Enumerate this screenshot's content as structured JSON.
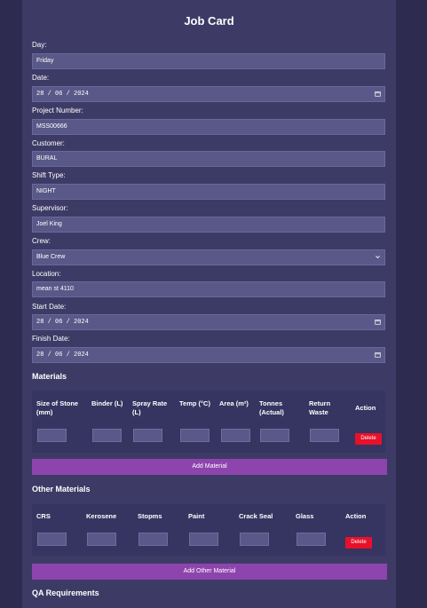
{
  "form": {
    "title": "Job Card",
    "fields": {
      "day": {
        "label": "Day:",
        "value": "Friday"
      },
      "date": {
        "label": "Date:",
        "value": "28 / 06 / 2024"
      },
      "project_number": {
        "label": "Project Number:",
        "value": "MSS00666"
      },
      "customer": {
        "label": "Customer:",
        "value": "BURAL"
      },
      "shift_type": {
        "label": "Shift Type:",
        "value": "NIGHT"
      },
      "supervisor": {
        "label": "Supervisor:",
        "value": "Joel King"
      },
      "crew": {
        "label": "Crew:",
        "value": "Blue Crew"
      },
      "location": {
        "label": "Location:",
        "value": "mean st 4110"
      },
      "start_date": {
        "label": "Start Date:",
        "value": "28 / 06 / 2024"
      },
      "finish_date": {
        "label": "Finish Date:",
        "value": "28 / 06 / 2024"
      }
    }
  },
  "materials": {
    "heading": "Materials",
    "columns": [
      "Size of Stone (mm)",
      "Binder (L)",
      "Spray Rate (L)",
      "Temp (°C)",
      "Area (m²)",
      "Tonnes (Actual)",
      "Return Waste",
      "Action"
    ],
    "delete_label": "Delete",
    "add_label": "Add Material"
  },
  "other_materials": {
    "heading": "Other Materials",
    "columns": [
      "CRS",
      "Kerosene",
      "Stopms",
      "Paint",
      "Crack Seal",
      "Glass",
      "Action"
    ],
    "delete_label": "Delete",
    "add_label": "Add Other Material"
  },
  "qa": {
    "heading": "QA Requirements"
  },
  "colors": {
    "page_bg": "#2d2b50",
    "card_bg": "#3d3b66",
    "field_bg": "#5a5888",
    "accent": "#8e44ad",
    "danger": "#e8102a"
  },
  "icons": {
    "calendar": "calendar-icon",
    "chevron": "chevron-down-icon"
  }
}
